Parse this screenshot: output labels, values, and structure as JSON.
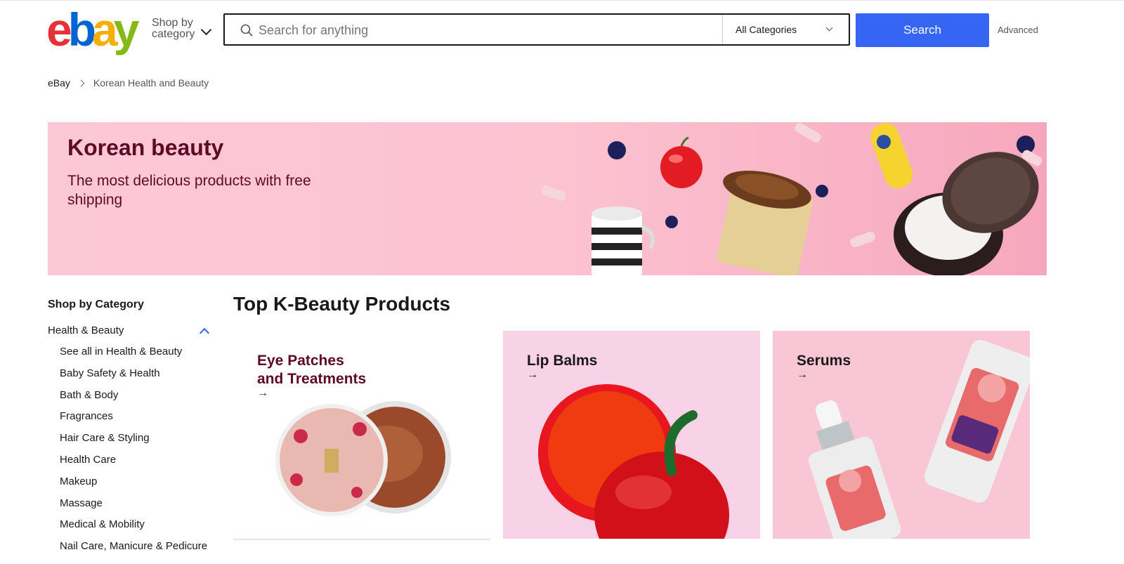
{
  "header": {
    "logo": {
      "letters": [
        "e",
        "b",
        "a",
        "y"
      ],
      "colors": [
        "#e53238",
        "#0064d2",
        "#f5af02",
        "#86b817"
      ]
    },
    "shop_by_line1": "Shop by",
    "shop_by_line2": "category",
    "search_placeholder": "Search for anything",
    "category_selected": "All Categories",
    "search_button": "Search",
    "advanced": "Advanced"
  },
  "breadcrumb": {
    "home": "eBay",
    "current": "Korean Health and Beauty"
  },
  "banner": {
    "title": "Korean beauty",
    "subtitle": "The most delicious products with free shipping"
  },
  "sidebar": {
    "heading": "Shop by Category",
    "category": "Health & Beauty",
    "items": [
      "See all in Health & Beauty",
      "Baby Safety & Health",
      "Bath & Body",
      "Fragrances",
      "Hair Care & Styling",
      "Health Care",
      "Makeup",
      "Massage",
      "Medical & Mobility",
      "Nail Care, Manicure & Pedicure"
    ]
  },
  "main": {
    "title": "Top K-Beauty Products",
    "cards": [
      {
        "line1": "Eye Patches",
        "line2": "and Treatments",
        "arrow": "→"
      },
      {
        "line1": "Lip Balms",
        "arrow": "→"
      },
      {
        "line1": "Serums",
        "arrow": "→"
      }
    ]
  },
  "colors": {
    "accent": "#3665f3",
    "banner_text": "#5d0a26"
  }
}
